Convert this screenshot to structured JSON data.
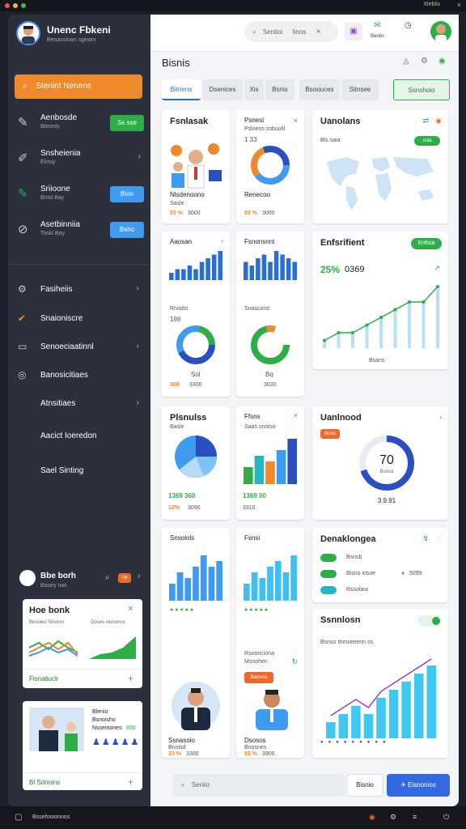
{
  "titlebar": {
    "right_label": "Xleblis",
    "close": "×"
  },
  "sidebar": {
    "app_title": "Unenc Fbkeni",
    "app_subtitle": "Beoassioan sgewni",
    "search_label": "Stenint Nenens",
    "cards": [
      {
        "t1": "Aenbosde",
        "t2": "Bteonty",
        "pill": "Ss sse",
        "pill_color": "#2fae47"
      },
      {
        "t1": "Snsheienia",
        "t2": "Elrisiy",
        "chev": "›"
      },
      {
        "t1": "Sriioone",
        "t2": "Bnisi Bay",
        "pill": "Bioo",
        "pill_color": "#3f9af0"
      },
      {
        "t1": "Asetbinniia",
        "t2": "Toski Bay",
        "pill": "Bsho",
        "pill_color": "#3f9af0"
      }
    ],
    "nav": [
      {
        "label": "Fasiheiis",
        "icon": "⚙",
        "chev": "›"
      },
      {
        "label": "Snaioniscre",
        "icon": "✔",
        "chev": ""
      },
      {
        "label": "Senoeciaatinnl",
        "icon": "▭",
        "chev": "›"
      },
      {
        "label": "Banosicitiaes",
        "icon": "◎",
        "chev": ""
      },
      {
        "label": "Atnsitiaes",
        "icon": "",
        "chev": "›"
      },
      {
        "label": "Aacict Ioeredon",
        "icon": "",
        "chev": ""
      },
      {
        "label": "Sael Sinting",
        "icon": "",
        "chev": ""
      }
    ],
    "profile": {
      "name": "Bbe borh",
      "sub": "Basey nas",
      "badge": "ra"
    },
    "mini1": {
      "title": "Hoe bonk",
      "sub1": "Besoies Sinoion",
      "sub2": "Doses xiononos",
      "foot": "Fisnatiuclr"
    },
    "mini2": {
      "l1": "Blenio",
      "l2": "Bsnoisho",
      "l3": "Nsseinones",
      "val": "850",
      "foot": "Bl Sdnnins"
    }
  },
  "topbar": {
    "search": "Sentioi",
    "search2": "Iinos",
    "clear": "×",
    "user_label": "Beobs"
  },
  "main": {
    "title": "Bisnis",
    "tabs": [
      "Bitnens",
      "Dsenices",
      "Xis",
      "Bsnis",
      "Bsoouces",
      "Sitnsee"
    ],
    "tab_button": "Ssnshoio",
    "cards": {
      "c1": {
        "title": "Fsnlasak",
        "label": "Nlsdenoono",
        "sub": "Sasle",
        "stat": "93 %",
        "stat2": "3000"
      },
      "c2": {
        "title": "Psnesi",
        "sub": "Psloens ssbuolil",
        "stat0": "1 33",
        "label": "Renecoo",
        "stat": "93 %",
        "stat2": "3000"
      },
      "c3": {
        "title": "Uanolans",
        "sub": "Bls saia",
        "badge": "snia"
      },
      "c4": {
        "title": "Aaosan",
        "label": "Rnodst",
        "val": "198",
        "stat": "308",
        "stat2": "3300",
        "foot": "Sol"
      },
      "c5": {
        "title": "Fsnonsnnt",
        "label": "Snascorst",
        "foot": "Bq",
        "stat": "3030"
      },
      "c6": {
        "title": "Enfsrifient",
        "badge": "Enflsia",
        "pct": "25%",
        "num": "0369",
        "xlabel": "Bsans"
      },
      "c7": {
        "title": "Plsnulss",
        "sub": "Basle",
        "stat": "1369 360",
        "stat2": "12%",
        "stat3": "3090"
      },
      "c8": {
        "title": "Ffsns",
        "sub": "Saas snotso",
        "stat": "1369 00",
        "stat2": "3310"
      },
      "c9": {
        "title": "Uanlnood",
        "badge": "Boso",
        "center": "70",
        "center_sub": "Bsnso",
        "foot": "3.9.91"
      },
      "c10": {
        "title": "Snsolols",
        "name": "Ssnasoio",
        "sub": "Bnoisd",
        "stat": "33 %",
        "stat2": "3300"
      },
      "c11": {
        "title": "Fsnsi",
        "sub1": "Rsoonciona",
        "sub2": "Msnohen",
        "bubble": "Baosoa",
        "name": "Dsosos",
        "sub": "Bnosnes",
        "stat": "92 %",
        "stat2": "3900"
      },
      "c12": {
        "title": "Denaklongea",
        "rows": [
          "Bsnsb",
          "Bisno iosoe",
          "Rssoliea"
        ],
        "stat": "5099"
      },
      "c13": {
        "title": "Ssnnlosn",
        "sub": "Bsnso ttnnsenenn ss"
      }
    },
    "bottom_search": "Seniio",
    "bottom_btn1": "Bisnio",
    "bottom_btn2": "Eisnonios"
  },
  "bottombar": {
    "label": "Bssehnoonnos"
  },
  "chart_data": [
    {
      "type": "bar",
      "values": [
        2,
        3,
        3,
        4,
        3,
        5,
        6,
        7,
        8
      ],
      "title": "Aaosan"
    },
    {
      "type": "bar",
      "values": [
        5,
        4,
        6,
        7,
        5,
        8,
        7,
        6,
        5
      ],
      "title": "Fsnonsnnt"
    },
    {
      "type": "line",
      "x": [
        0,
        1,
        2,
        3,
        4,
        5,
        6,
        7,
        8
      ],
      "values": [
        1,
        2,
        2,
        3,
        4,
        5,
        6,
        6,
        8
      ],
      "title": "Enfsrifient"
    },
    {
      "type": "bar",
      "values": [
        3,
        5,
        4,
        6,
        8
      ],
      "title": "Ffsns"
    },
    {
      "type": "bar",
      "values": [
        3,
        5,
        4,
        6,
        8,
        6,
        7
      ],
      "title": "Snsolols"
    },
    {
      "type": "bar",
      "values": [
        3,
        5,
        4,
        6,
        7,
        5,
        8
      ],
      "title": "Fsnsi"
    },
    {
      "type": "bar",
      "values": [
        2,
        3,
        4,
        3,
        5,
        6,
        7,
        8,
        9
      ],
      "title": "Ssnnlosn"
    }
  ],
  "colors": {
    "orange": "#ee8a2b",
    "green": "#2fae47",
    "blue": "#3f9af0",
    "sidebar": "#2b303c"
  }
}
